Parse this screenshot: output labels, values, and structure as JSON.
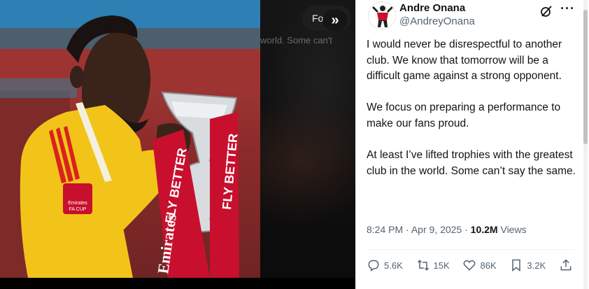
{
  "viewer": {
    "background_text": "world. Some can't",
    "background_pill": "Fo",
    "next_glyph": "»",
    "banner_text_left": "FLY BETTER",
    "banner_text_right": "FLY BETTER",
    "banner_brand": "Emirates",
    "badge_line1": "Emirates",
    "badge_line2": "FA CUP"
  },
  "tweet": {
    "author_name": "Andre Onana",
    "author_handle": "@AndreyOnana",
    "paragraphs": [
      "I would never be disrespectful to another club. We know that tomorrow will be a difficult game against a strong opponent.",
      "We focus on preparing a performance to make our fans proud.",
      "At least I’ve lifted trophies with the greatest club in the world. Some can’t say the same."
    ],
    "time": "8:24 PM",
    "separator": "·",
    "date": "Apr 9, 2025",
    "views_count": "10.2M",
    "views_label": "Views",
    "more_label": "···"
  },
  "actions": {
    "replies": "5.6K",
    "reposts": "15K",
    "likes": "86K",
    "bookmarks": "3.2K"
  },
  "colors": {
    "text_primary": "#0f1419",
    "text_secondary": "#536471",
    "jersey_yellow": "#f2c41a",
    "banner_red": "#c8102e"
  },
  "icons": [
    "chevron-double-right-icon",
    "grok-icon",
    "more-icon",
    "reply-icon",
    "repost-icon",
    "like-icon",
    "bookmark-icon",
    "share-icon"
  ]
}
